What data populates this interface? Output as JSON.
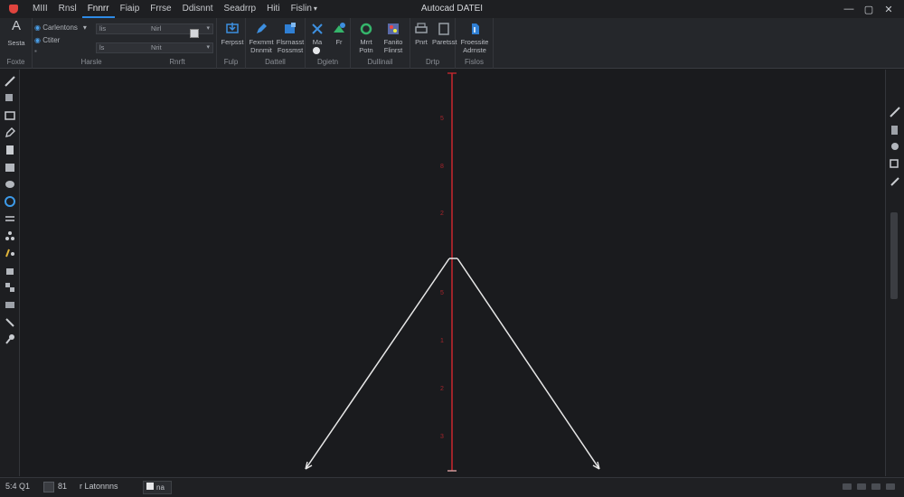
{
  "window": {
    "title": "Autocad DATEI"
  },
  "menu": {
    "items": [
      "MIII",
      "Rnsl",
      "Fnnrr",
      "Fiaip",
      "Frrse",
      "Ddisnnt",
      "Seadrrp",
      "Hiti",
      "Fislin"
    ],
    "active_index": 2
  },
  "ribbon": {
    "groups": [
      {
        "label": "Foxte"
      },
      {
        "label": "Harsle"
      },
      {
        "label": "Rnrft"
      },
      {
        "label": "Fulp"
      },
      {
        "label": "Dattell"
      },
      {
        "label": "Dgietn"
      },
      {
        "label": "Dullinail"
      },
      {
        "label": "Drtp"
      },
      {
        "label": "Fislos"
      }
    ],
    "text_tool": {
      "icon": "A",
      "label": "Sesta"
    },
    "props": {
      "line1": "Carlentons",
      "line2": "Ctiter",
      "field1_label": "lis",
      "field1_value": "Nirl",
      "field2_label": "ls",
      "field2_value": "Nrit"
    },
    "buttons": [
      {
        "label": "Ferpsst"
      },
      {
        "label": "Fexmmt\nDnnmit"
      },
      {
        "label": "Flsrnasst\nFossmst"
      },
      {
        "label": "Ma"
      },
      {
        "label": "Fr"
      },
      {
        "label": "Mrrt\nPotn"
      },
      {
        "label": "Fanito\nFlinrst"
      },
      {
        "label": "Pnrt"
      },
      {
        "label": "Paretsst"
      },
      {
        "label": "Froessite\nAdrnste"
      }
    ]
  },
  "axis_labels": [
    "5",
    "8",
    "2",
    "5",
    "1",
    "2",
    "3"
  ],
  "status": {
    "coords": "5:4 Q1",
    "num": "81",
    "layout_label": "r Latonnns",
    "tab_label": "na"
  },
  "colors": {
    "accent": "#2d8ae6",
    "axis_red": "#c0272d",
    "line_white": "#e8e8e8",
    "canvas_bg": "#1a1b1e"
  }
}
